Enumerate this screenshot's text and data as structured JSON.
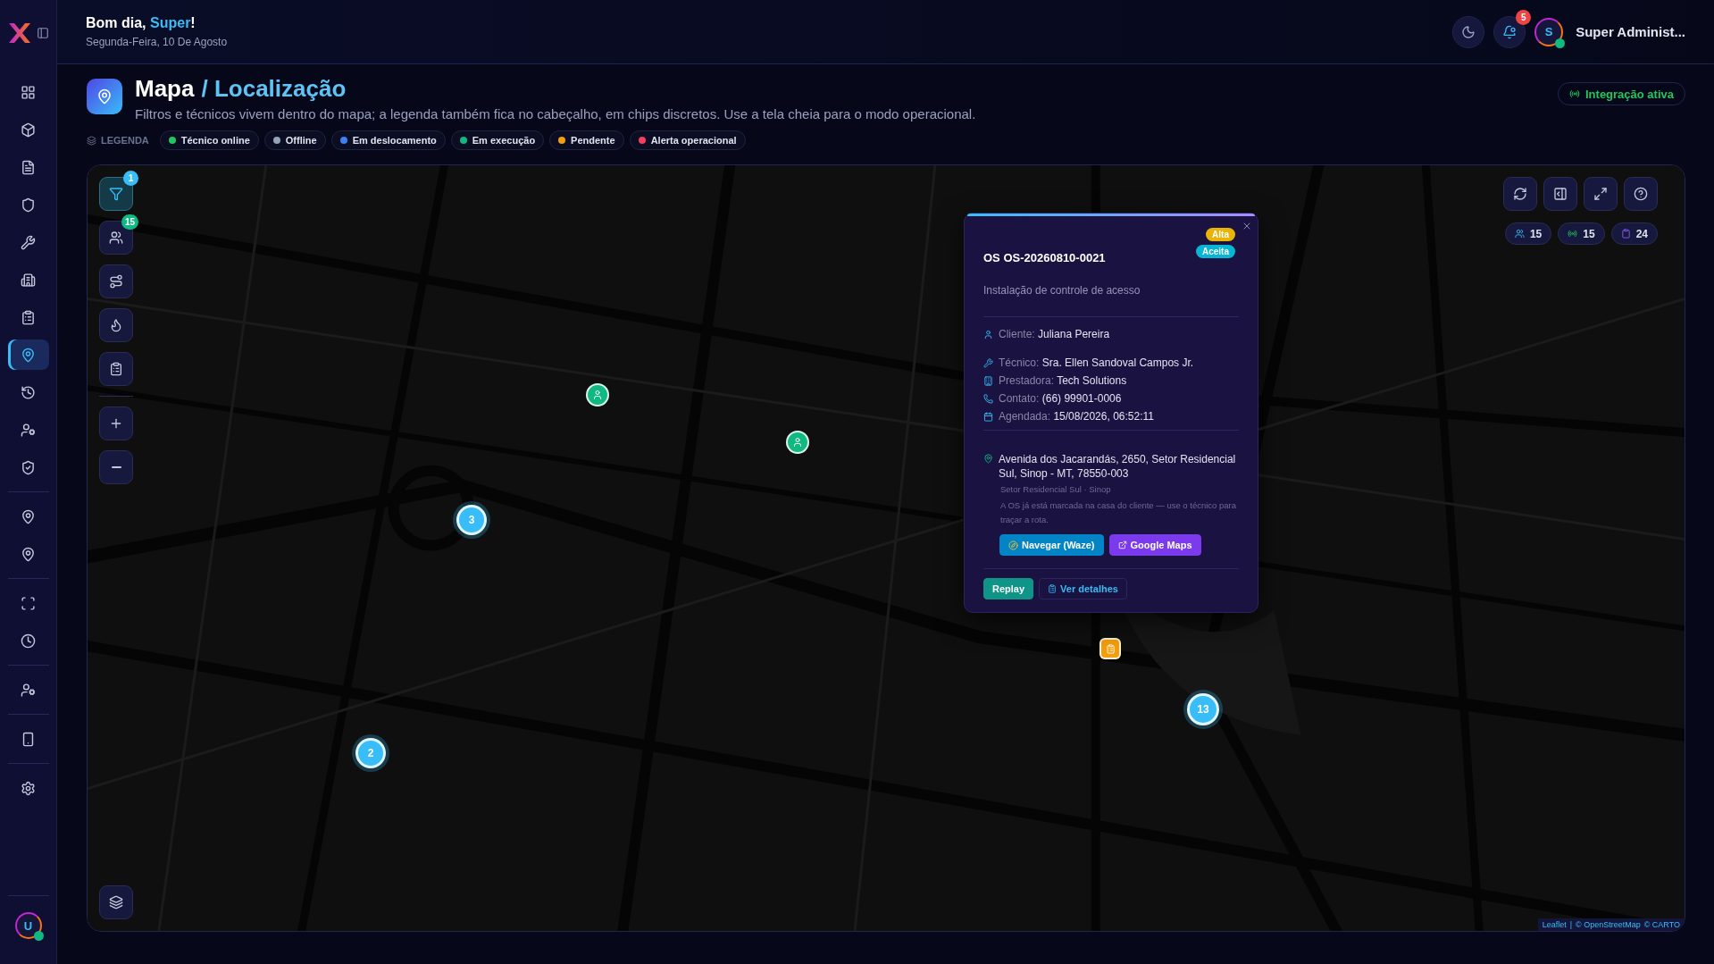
{
  "sidebar": {
    "groups": [
      [
        {
          "kind": "dashboard",
          "selected": false
        },
        {
          "kind": "box",
          "selected": false
        },
        {
          "kind": "document",
          "selected": false
        },
        {
          "kind": "shield",
          "selected": false
        },
        {
          "kind": "wrench",
          "selected": false
        },
        {
          "kind": "building",
          "selected": false
        },
        {
          "kind": "clipboard",
          "selected": false
        },
        {
          "kind": "pin",
          "selected": true
        },
        {
          "kind": "history",
          "selected": false
        },
        {
          "kind": "user-cog",
          "selected": false
        },
        {
          "kind": "shield-check",
          "selected": false
        }
      ],
      [
        {
          "kind": "pin",
          "selected": false
        },
        {
          "kind": "pin",
          "selected": false
        }
      ],
      [
        {
          "kind": "scan",
          "selected": false
        },
        {
          "kind": "clock",
          "selected": false
        }
      ],
      [
        {
          "kind": "user-cog",
          "selected": false
        }
      ],
      [
        {
          "kind": "phone",
          "selected": false
        }
      ],
      [
        {
          "kind": "settings",
          "selected": false
        }
      ]
    ],
    "avatar": "U"
  },
  "header": {
    "greeting": "Bom dia, **Super**!",
    "date": "Segunda-Feira, 10 De Agosto",
    "notifications": "5",
    "avatar": "S",
    "user": "Super Administ..."
  },
  "page": {
    "title": "Mapa",
    "breadcrumb": "/ Localização",
    "description": "Filtros e técnicos vivem dentro do mapa; a legenda também fica no cabeçalho, em chips discretos. Use a tela cheia para o modo operacional.",
    "integration": "Integração ativa"
  },
  "legend": {
    "label": "LEGENDA",
    "items": [
      {
        "label": "Técnico online",
        "color": "#22c55e"
      },
      {
        "label": "Offline",
        "color": "#94a3b8"
      },
      {
        "label": "Em deslocamento",
        "color": "#3b82f6"
      },
      {
        "label": "Em execução",
        "color": "#10b981"
      },
      {
        "label": "Pendente",
        "color": "#f59e0b"
      },
      {
        "label": "Alerta operacional",
        "color": "#f43f5e"
      }
    ]
  },
  "map": {
    "filter_badge": "1",
    "technicians_badge": "15",
    "stats": [
      {
        "kind": "users",
        "value": "15"
      },
      {
        "kind": "signal",
        "value": "15"
      },
      {
        "kind": "orders",
        "value": "24"
      }
    ],
    "markers": [
      {
        "kind": "technician"
      },
      {
        "kind": "technician"
      },
      {
        "kind": "cluster",
        "count": "3"
      },
      {
        "kind": "cluster",
        "count": "2"
      },
      {
        "kind": "cluster",
        "count": "13"
      },
      {
        "kind": "order"
      }
    ],
    "attribution": {
      "leaflet": "Leaflet",
      "separator": "|",
      "sources": [
        "© OpenStreetMap",
        "© CARTO"
      ]
    }
  },
  "popup": {
    "priority": "Alta",
    "status": "Aceita",
    "title": "OS OS-20260810-0021",
    "service": "Instalação de controle de acesso",
    "fields": [
      {
        "kind": "client",
        "label": "Cliente:",
        "value": "Juliana Pereira"
      },
      {
        "kind": "technician",
        "label": "Técnico:",
        "value": "Sra. Ellen Sandoval Campos Jr."
      },
      {
        "kind": "provider",
        "label": "Prestadora:",
        "value": "Tech Solutions"
      },
      {
        "kind": "contact",
        "label": "Contato:",
        "value": "(66) 99901-0006"
      },
      {
        "kind": "scheduled",
        "label": "Agendada:",
        "value": "15/08/2026, 06:52:11"
      }
    ],
    "address": "Avenida dos Jacarandás, 2650, Setor Residencial Sul, Sinop - MT, 78550-003",
    "area": "Setor Residencial Sul · Sinop",
    "note": "A OS já está marcada na casa do cliente — use o técnico para traçar a rota.",
    "waze": "Navegar (Waze)",
    "google": "Google Maps",
    "replay": "Replay",
    "details": "Ver detalhes"
  }
}
